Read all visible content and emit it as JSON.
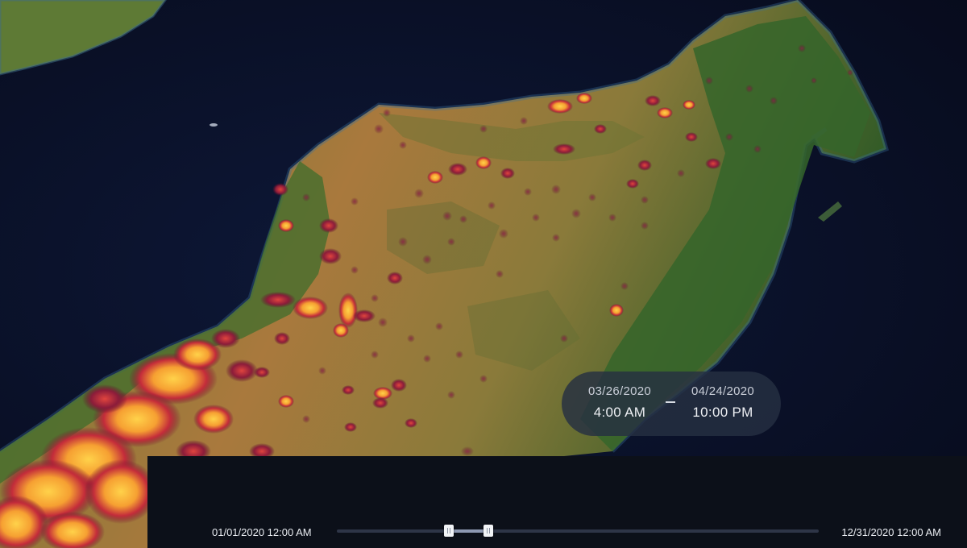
{
  "date_range": {
    "start_date": "03/26/2020",
    "start_time": "4:00 AM",
    "separator": "–",
    "end_date": "04/24/2020",
    "end_time": "10:00 PM"
  },
  "timeline": {
    "start_label": "01/01/2020 12:00 AM",
    "end_label": "12/31/2020 12:00 AM",
    "selected_start_fraction": 0.233,
    "selected_end_fraction": 0.315
  },
  "colors": {
    "ocean": "#0a0f22",
    "land_green": "#3f6a2e",
    "land_dry": "#a07a3e",
    "fire_outer": "#6a1030",
    "fire_mid": "#c8303a",
    "fire_hot": "#fbbd3a",
    "panel": "#0c1019"
  }
}
